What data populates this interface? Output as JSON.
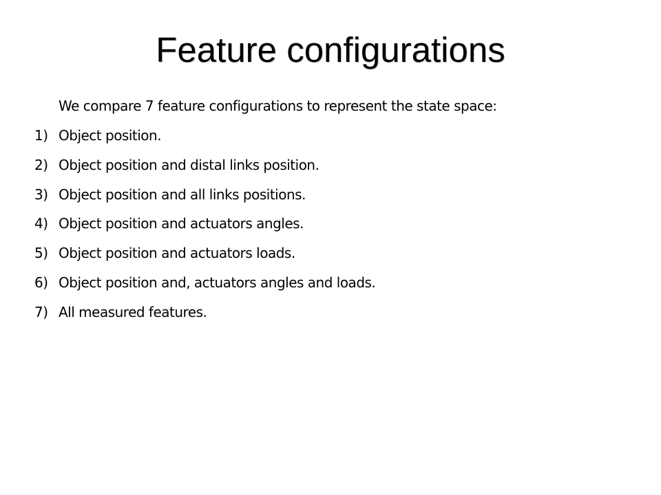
{
  "slide": {
    "title": "Feature configurations",
    "intro": "We compare 7 feature configurations to represent the state space:",
    "items": [
      {
        "number": "1)",
        "text": "Object position."
      },
      {
        "number": "2)",
        "text": "Object position and distal links position."
      },
      {
        "number": "3)",
        "text": "Object position and all links positions."
      },
      {
        "number": "4)",
        "text": "Object position and actuators angles."
      },
      {
        "number": "5)",
        "text": "Object position and actuators loads."
      },
      {
        "number": "6)",
        "text": "Object position and, actuators angles and loads."
      },
      {
        "number": "7)",
        "text": "All measured features."
      }
    ]
  }
}
